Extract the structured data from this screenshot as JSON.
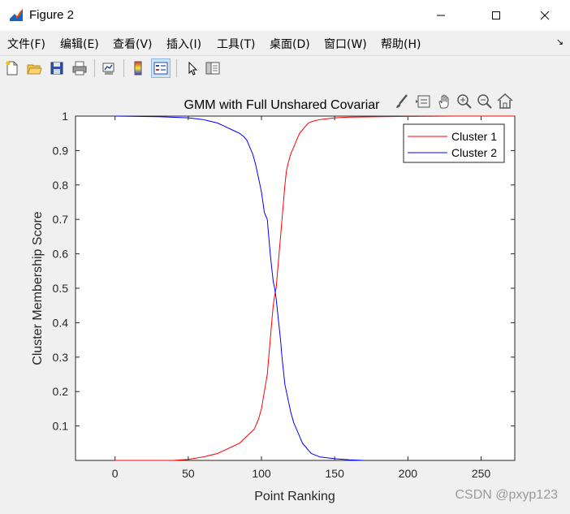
{
  "window": {
    "title": "Figure 2",
    "controls": [
      "minimize",
      "maximize",
      "close"
    ]
  },
  "menu": {
    "items": [
      "文件(F)",
      "编辑(E)",
      "查看(V)",
      "插入(I)",
      "工具(T)",
      "桌面(D)",
      "窗口(W)",
      "帮助(H)"
    ],
    "overflow_icon": "dock-arrow-icon"
  },
  "toolbar": {
    "buttons": [
      "new-figure-icon",
      "open-file-icon",
      "save-icon",
      "print-icon",
      "link-plot-icon",
      "colorbar-icon",
      "legend-icon",
      "pointer-icon",
      "property-inspector-icon"
    ],
    "active": "legend-icon"
  },
  "axes_toolbar": {
    "buttons": [
      "brush-icon",
      "data-tips-icon",
      "pan-icon",
      "zoom-in-icon",
      "zoom-out-icon",
      "home-icon"
    ]
  },
  "watermark": "CSDN @pxyp123",
  "chart_data": {
    "type": "line",
    "title": "GMM with Full Unshared Covariar",
    "xlabel": "Point Ranking",
    "ylabel": "Cluster Membership Score",
    "xlim": [
      -27,
      273
    ],
    "ylim": [
      0.0,
      1.0
    ],
    "xticks": [
      0,
      50,
      100,
      150,
      200,
      250
    ],
    "yticks": [
      0.1,
      0.2,
      0.3,
      0.4,
      0.5,
      0.6,
      0.7,
      0.8,
      0.9,
      1
    ],
    "grid": false,
    "legend_position": "top-right",
    "series": [
      {
        "name": "Cluster 1",
        "color": "#ff0000",
        "x": [
          0,
          10,
          20,
          30,
          40,
          50,
          60,
          70,
          75,
          80,
          85,
          90,
          95,
          98,
          100,
          102,
          104,
          105,
          106,
          107,
          108,
          109,
          110,
          111,
          112,
          113,
          114,
          115,
          116,
          117,
          118,
          119,
          120,
          122,
          124,
          126,
          128,
          130,
          132,
          135,
          140,
          150,
          160,
          180,
          200,
          230,
          273
        ],
        "y": [
          0.0,
          0.0,
          0.0,
          0.0,
          0.0,
          0.003,
          0.01,
          0.02,
          0.03,
          0.04,
          0.05,
          0.07,
          0.09,
          0.12,
          0.15,
          0.2,
          0.25,
          0.3,
          0.35,
          0.4,
          0.45,
          0.48,
          0.5,
          0.55,
          0.6,
          0.65,
          0.7,
          0.75,
          0.8,
          0.84,
          0.86,
          0.875,
          0.89,
          0.91,
          0.93,
          0.95,
          0.96,
          0.97,
          0.98,
          0.985,
          0.99,
          0.995,
          0.997,
          0.998,
          0.999,
          1.0,
          1.0
        ]
      },
      {
        "name": "Cluster 2",
        "color": "#0000ff",
        "x": [
          0,
          30,
          50,
          60,
          70,
          75,
          80,
          85,
          88,
          90,
          92,
          94,
          96,
          98,
          100,
          101,
          102,
          103,
          104,
          105,
          106,
          107,
          108,
          109,
          110,
          111,
          112,
          113,
          114,
          115,
          116,
          118,
          120,
          122,
          124,
          126,
          128,
          130,
          134,
          140,
          150,
          160,
          170
        ],
        "y": [
          1.0,
          0.998,
          0.995,
          0.99,
          0.98,
          0.97,
          0.96,
          0.95,
          0.94,
          0.93,
          0.91,
          0.89,
          0.86,
          0.82,
          0.78,
          0.75,
          0.72,
          0.71,
          0.7,
          0.65,
          0.6,
          0.56,
          0.52,
          0.5,
          0.47,
          0.43,
          0.39,
          0.35,
          0.3,
          0.26,
          0.22,
          0.18,
          0.14,
          0.11,
          0.09,
          0.07,
          0.05,
          0.04,
          0.02,
          0.01,
          0.005,
          0.002,
          0.0
        ]
      }
    ]
  }
}
